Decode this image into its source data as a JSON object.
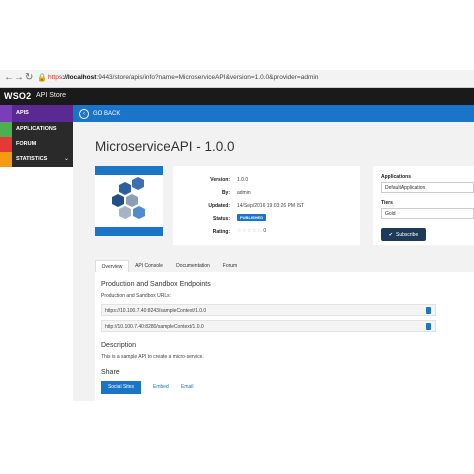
{
  "browser": {
    "url_scheme": "https",
    "url_host": "://localhost",
    "url_rest": ":9443/store/apis/info?name=MicroserviceAPI&version=1.0.0&provider=admin"
  },
  "app": {
    "logo": "WSO2",
    "store_name": "API Store"
  },
  "sidebar": {
    "items": [
      {
        "label": "APIS",
        "color": "#7a3fb8",
        "icon": "gear-icon"
      },
      {
        "label": "APPLICATIONS",
        "color": "#4caf50",
        "icon": "grid-icon"
      },
      {
        "label": "FORUM",
        "color": "#e53935",
        "icon": "chat-icon"
      },
      {
        "label": "STATISTICS",
        "color": "#f39c12",
        "icon": "chart-icon"
      }
    ]
  },
  "topbar": {
    "go_back": "GO BACK"
  },
  "api": {
    "title": "MicroserviceAPI - 1.0.0",
    "details": [
      {
        "label": "Version:",
        "value": "1.0.0"
      },
      {
        "label": "By:",
        "value": "admin"
      },
      {
        "label": "Updated:",
        "value": "14/Sep/2016 19:03:26 PM IST"
      },
      {
        "label": "Status:",
        "value": "PUBLISHED"
      },
      {
        "label": "Rating:",
        "value": "☆☆☆☆☆"
      }
    ],
    "rating_count": "0"
  },
  "subscription": {
    "applications_label": "Applications",
    "application_value": "DefaultApplication",
    "tiers_label": "Tiers",
    "tier_value": "Gold",
    "subscribe_label": "Subscribe"
  },
  "tabs": [
    "Overview",
    "API Console",
    "Documentation",
    "Forum"
  ],
  "overview": {
    "endpoints_heading": "Production and Sandbox Endpoints",
    "endpoints_sub": "Production and Sandbox URLs:",
    "endpoints": [
      "https://10.100.7.40:8243/sampleContext/1.0.0",
      "http://10.100.7.40:8280/sampleContext/1.0.0"
    ],
    "description_heading": "Description",
    "description_text": "This is a sample API to create a micro-service.",
    "share_heading": "Share",
    "share_social": "Social Sites",
    "share_embed": "Embed",
    "share_email": "Email"
  },
  "colors": {
    "accent": "#1a74c8",
    "header": "#1a1a1a",
    "subscribe": "#1c3b5a"
  }
}
